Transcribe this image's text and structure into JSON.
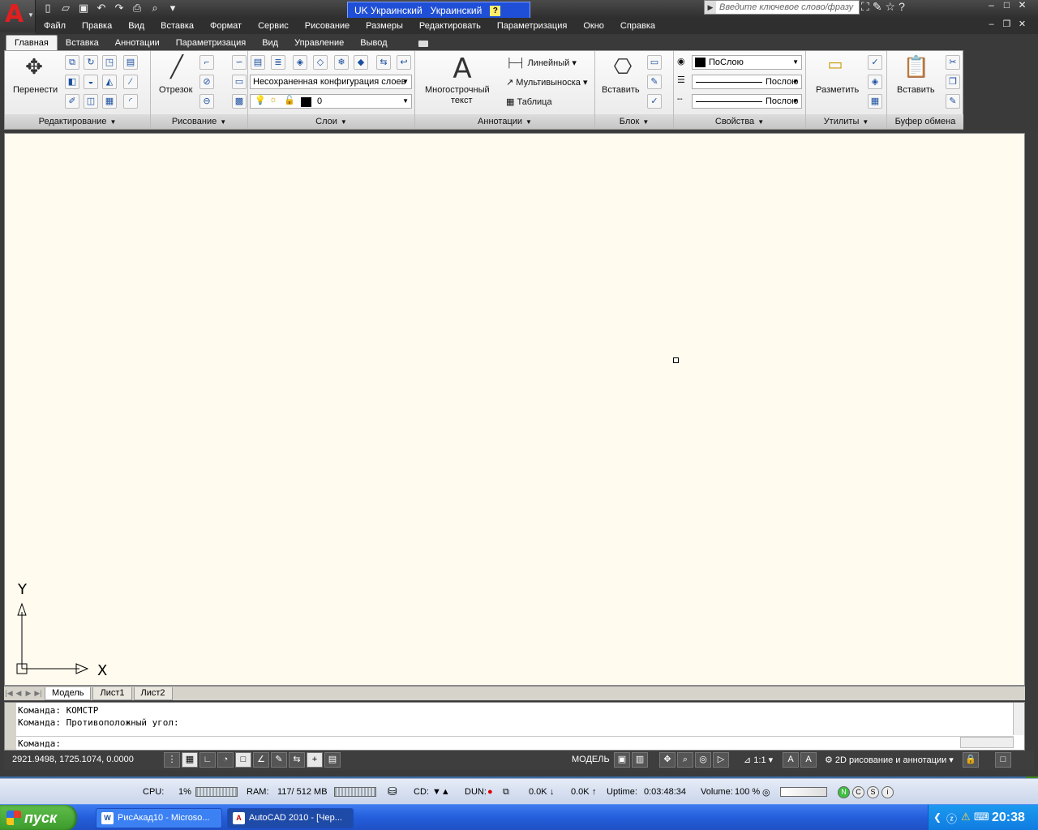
{
  "title_bar": {
    "language_indicator": "UK Украинский",
    "keyboard_layout": "Украинский",
    "help_glyph": "?",
    "search_placeholder": "Введите ключевое слово/фразу"
  },
  "menu": [
    "Файл",
    "Правка",
    "Вид",
    "Вставка",
    "Формат",
    "Сервис",
    "Рисование",
    "Размеры",
    "Редактировать",
    "Параметризация",
    "Окно",
    "Справка"
  ],
  "ribbon_tabs": [
    "Главная",
    "Вставка",
    "Аннотации",
    "Параметризация",
    "Вид",
    "Управление",
    "Вывод"
  ],
  "panels": {
    "edit": {
      "title": "Редактирование",
      "move_label": "Перенести"
    },
    "draw": {
      "title": "Рисование",
      "line_label": "Отрезок"
    },
    "layers": {
      "title": "Слои",
      "config_value": "Несохраненная конфигурация слоев",
      "layer_value": "0"
    },
    "annotations": {
      "title": "Аннотации",
      "mtext_label_1": "Многострочный",
      "mtext_label_2": "текст",
      "linear_label": "Линейный",
      "multileader_label": "Мультивыноска",
      "table_label": "Таблица"
    },
    "block": {
      "title": "Блок",
      "insert_label": "Вставить"
    },
    "properties": {
      "title": "Свойства",
      "color_value": "ПоСлою",
      "linetype_value": "Послою",
      "lineweight_value": "Послою"
    },
    "utilities": {
      "title": "Утилиты",
      "measure_label": "Разметить"
    },
    "clipboard": {
      "title": "Буфер обмена",
      "paste_label": "Вставить"
    }
  },
  "ucs": {
    "x_label": "X",
    "y_label": "Y"
  },
  "layout_tabs": [
    "Модель",
    "Лист1",
    "Лист2"
  ],
  "command_history": [
    "Команда: КОМСТР",
    "Команда: Противоположный угол:"
  ],
  "command_prompt": "Команда:",
  "status_bar": {
    "coordinates": "2921.9498, 1725.1074, 0.0000",
    "model_label": "МОДЕЛЬ",
    "scale": "1:1",
    "workspace": "2D рисование и аннотации"
  },
  "monitor": {
    "cpu_label": "CPU:",
    "cpu_value": "1%",
    "ram_label": "RAM:",
    "ram_value": "117/ 512 MB",
    "cd_label": "CD:",
    "dun_label": "DUN:",
    "down_rate": "0.0K",
    "up_rate": "0.0K",
    "uptime_label": "Uptime:",
    "uptime_value": "0:03:48:34",
    "volume_label": "Volume:",
    "volume_value": "100 %"
  },
  "taskbar": {
    "start_label": "пуск",
    "tasks": [
      "РисАкад10 - Microso...",
      "AutoCAD 2010 - [Чер..."
    ],
    "clock": "20:38"
  }
}
